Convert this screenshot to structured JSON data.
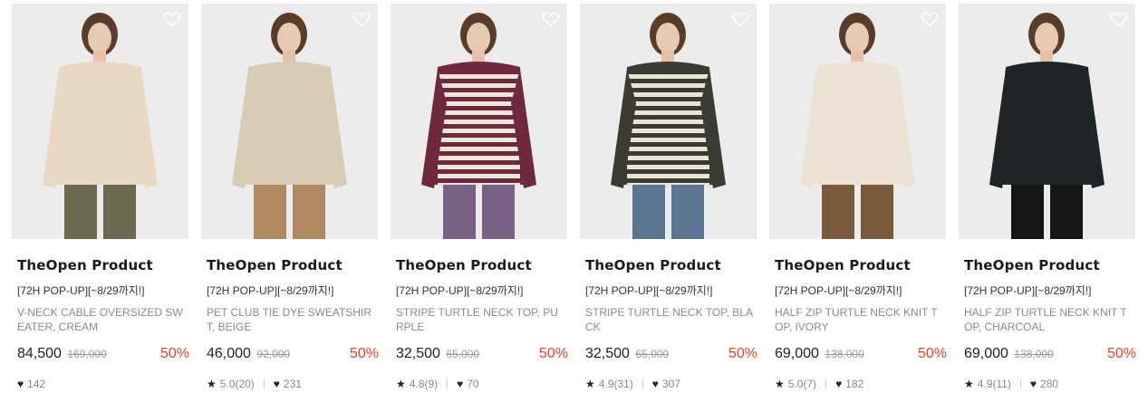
{
  "colors": {
    "discount": "#e8442a",
    "brand_text": "#1a1a1a",
    "muted": "#8a8a8a"
  },
  "icons": {
    "wishlist": "heart-outline-icon",
    "rating": "star-icon",
    "likes": "heart-filled-icon"
  },
  "products": [
    {
      "brand": "TheOpen Product",
      "promo": "[72H POP-UP][~8/29까지!]",
      "name": "V-NECK CABLE OVERSIZED SWEATER, CREAM",
      "price": "84,500",
      "original_price": "169,000",
      "discount": "50%",
      "rating": "",
      "likes": "142",
      "garment_color": "#e9d9c3",
      "bottom_color": "#6b6a4f"
    },
    {
      "brand": "TheOpen Product",
      "promo": "[72H POP-UP][~8/29까지!]",
      "name": "PET CLUB TIE DYE SWEATSHIRT, BEIGE",
      "price": "46,000",
      "original_price": "92,000",
      "discount": "50%",
      "rating": "5.0(20)",
      "likes": "231",
      "garment_color": "#d9ccb5",
      "bottom_color": "#b08a62"
    },
    {
      "brand": "TheOpen Product",
      "promo": "[72H POP-UP][~8/29까지!]",
      "name": "STRIPE TURTLE NECK TOP, PURPLE",
      "price": "32,500",
      "original_price": "65,000",
      "discount": "50%",
      "rating": "4.8(9)",
      "likes": "70",
      "garment_color": "#6e2a3c",
      "bottom_color": "#7a6185"
    },
    {
      "brand": "TheOpen Product",
      "promo": "[72H POP-UP][~8/29까지!]",
      "name": "STRIPE TURTLE NECK TOP, BLACK",
      "price": "32,500",
      "original_price": "65,000",
      "discount": "50%",
      "rating": "4.9(31)",
      "likes": "307",
      "garment_color": "#3b3b33",
      "bottom_color": "#5c7592"
    },
    {
      "brand": "TheOpen Product",
      "promo": "[72H POP-UP][~8/29까지!]",
      "name": "HALF ZIP TURTLE NECK KNIT TOP, IVORY",
      "price": "69,000",
      "original_price": "138,000",
      "discount": "50%",
      "rating": "5.0(7)",
      "likes": "182",
      "garment_color": "#ece3d2",
      "bottom_color": "#7a5a3a"
    },
    {
      "brand": "TheOpen Product",
      "promo": "[72H POP-UP][~8/29까지!]",
      "name": "HALF ZIP TURTLE NECK KNIT TOP, CHARCOAL",
      "price": "69,000",
      "original_price": "138,000",
      "discount": "50%",
      "rating": "4.9(11)",
      "likes": "280",
      "garment_color": "#1f2426",
      "bottom_color": "#151515"
    }
  ]
}
